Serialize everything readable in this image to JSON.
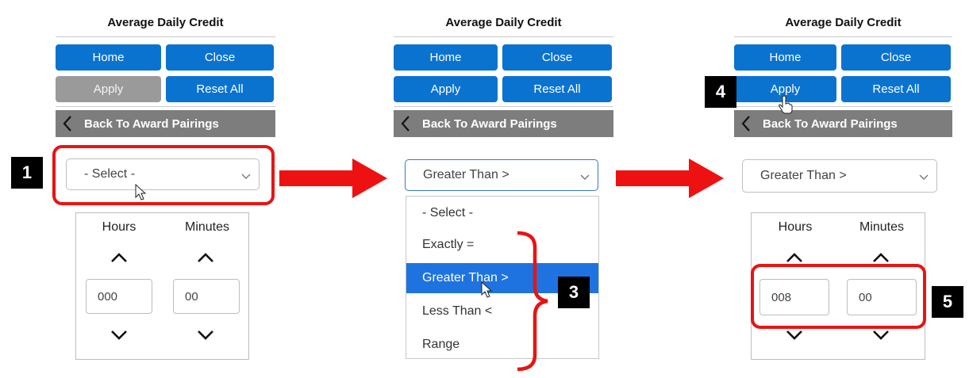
{
  "panels": [
    {
      "title": "Average Daily Credit",
      "buttons": {
        "home": "Home",
        "close": "Close",
        "apply": "Apply",
        "reset": "Reset All"
      },
      "back": "Back To Award Pairings",
      "select_value": "- Select -",
      "hours_label": "Hours",
      "minutes_label": "Minutes",
      "hours_value": "000",
      "minutes_value": "00"
    },
    {
      "title": "Average Daily Credit",
      "buttons": {
        "home": "Home",
        "close": "Close",
        "apply": "Apply",
        "reset": "Reset All"
      },
      "back": "Back To Award Pairings",
      "select_value": "Greater Than >",
      "options": [
        "- Select -",
        "Exactly =",
        "Greater Than >",
        "Less Than <",
        "Range"
      ],
      "selected_option": "Greater Than >"
    },
    {
      "title": "Average Daily Credit",
      "buttons": {
        "home": "Home",
        "close": "Close",
        "apply": "Apply",
        "reset": "Reset All"
      },
      "back": "Back To Award Pairings",
      "select_value": "Greater Than >",
      "hours_label": "Hours",
      "minutes_label": "Minutes",
      "hours_value": "008",
      "minutes_value": "00"
    }
  ],
  "step_labels": [
    "1",
    "3",
    "4",
    "5"
  ],
  "colors": {
    "primary": "#0a73d0",
    "disabled": "#9a9a9a",
    "backbar": "#7d7d7d",
    "highlight": "#e81414",
    "selected": "#1e73e0"
  }
}
